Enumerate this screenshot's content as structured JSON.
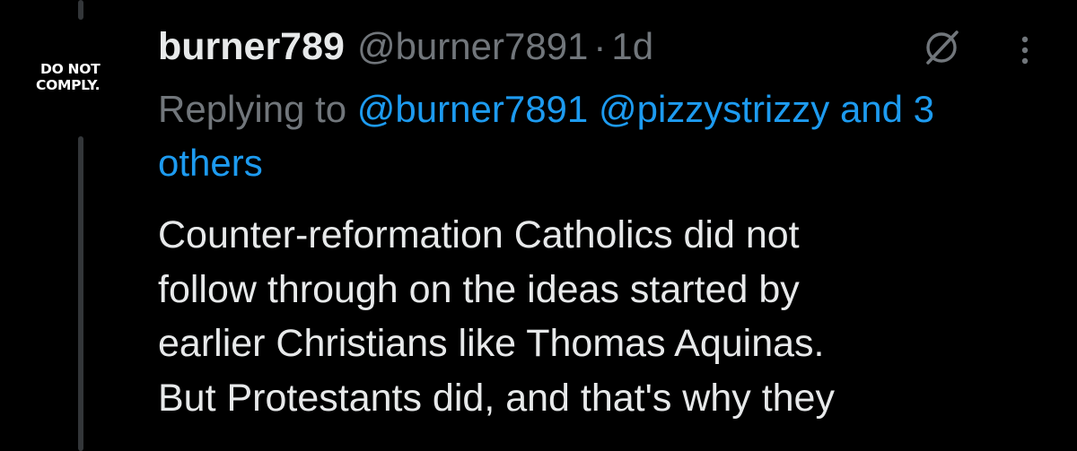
{
  "avatar": {
    "line1": "DO NOT",
    "line2": "COMPLY."
  },
  "tweet": {
    "display_name": "burner789",
    "handle": "@burner7891",
    "separator": "·",
    "time": "1d",
    "replying_prefix": "Replying to",
    "mentions": [
      "@burner7891",
      "@pizzystrizzy"
    ],
    "others": "and 3 others",
    "text_lines": [
      "Counter-reformation Catholics did not",
      "follow through on the ideas started by",
      "earlier Christians like Thomas Aquinas.",
      "But Protestants did, and that's why they"
    ]
  },
  "icons": {
    "grok": "grok-icon",
    "more": "more-options-icon"
  },
  "colors": {
    "background": "#000000",
    "primary_text": "#e7e9ea",
    "secondary_text": "#71767b",
    "link": "#1d9bf0",
    "thread_line": "#333639"
  }
}
